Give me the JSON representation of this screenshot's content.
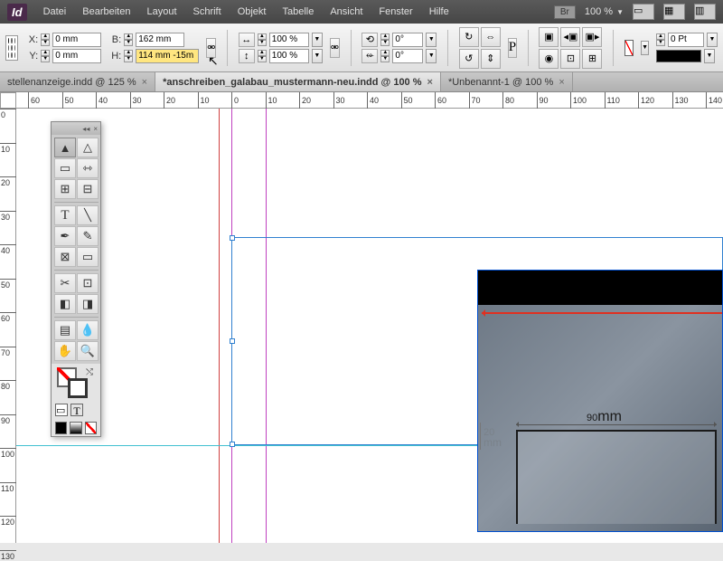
{
  "app": {
    "name": "Id"
  },
  "menu": {
    "items": [
      "Datei",
      "Bearbeiten",
      "Layout",
      "Schrift",
      "Objekt",
      "Tabelle",
      "Ansicht",
      "Fenster",
      "Hilfe"
    ]
  },
  "top_right": {
    "br": "Br",
    "zoom": "100 %"
  },
  "ctrl": {
    "x_label": "X:",
    "x": "0 mm",
    "y_label": "Y:",
    "y": "0 mm",
    "w_label": "B:",
    "w": "162 mm",
    "h_label": "H:",
    "h": "114 mm -15m",
    "scale_x": "100 %",
    "scale_y": "100 %",
    "rotate": "0°",
    "shear": "0°",
    "stroke_pt": "0 Pt"
  },
  "tabs": [
    {
      "label": "stellenanzeige.indd @ 125 %",
      "active": false
    },
    {
      "label": "*anschreiben_galabau_mustermann-neu.indd @ 100 %",
      "active": true
    },
    {
      "label": "*Unbenannt-1 @ 100 %",
      "active": false
    }
  ],
  "ruler_h": [
    "60",
    "50",
    "40",
    "30",
    "20",
    "10",
    "0",
    "10",
    "20",
    "30",
    "40",
    "50",
    "60",
    "70",
    "80",
    "90",
    "100",
    "110",
    "120",
    "130",
    "140"
  ],
  "ruler_v": [
    "0",
    "10",
    "20",
    "30",
    "40",
    "50",
    "60",
    "70",
    "80",
    "90",
    "100",
    "110",
    "120",
    "130"
  ],
  "image": {
    "dim1": "90",
    "dim1_unit": "mm",
    "dim2": "20",
    "dim2_unit": "mm"
  },
  "tools": {
    "fill": "none",
    "stroke": "#000"
  }
}
